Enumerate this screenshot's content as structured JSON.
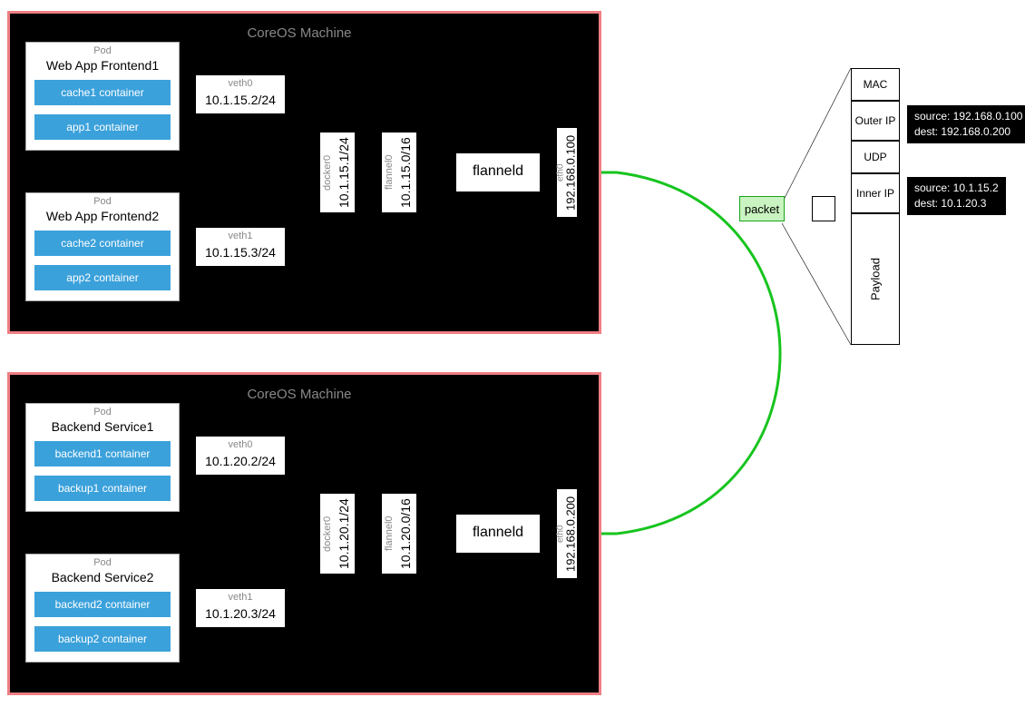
{
  "machines": {
    "top": {
      "title": "CoreOS Machine",
      "pods": [
        {
          "label": "Pod",
          "title": "Web App Frontend1",
          "c1": "cache1 container",
          "c2": "app1 container"
        },
        {
          "label": "Pod",
          "title": "Web App Frontend2",
          "c1": "cache2 container",
          "c2": "app2 container"
        }
      ],
      "veth0": {
        "label": "veth0",
        "val": "10.1.15.2/24"
      },
      "veth1": {
        "label": "veth1",
        "val": "10.1.15.3/24"
      },
      "docker0": {
        "label": "docker0",
        "val": "10.1.15.1/24"
      },
      "flannel0": {
        "label": "flannel0",
        "val": "10.1.15.0/16"
      },
      "flanneld": "flanneld",
      "eth0": {
        "label": "eth0",
        "val": "192.168.0.100"
      }
    },
    "bottom": {
      "title": "CoreOS Machine",
      "pods": [
        {
          "label": "Pod",
          "title": "Backend Service1",
          "c1": "backend1 container",
          "c2": "backup1 container"
        },
        {
          "label": "Pod",
          "title": "Backend Service2",
          "c1": "backend2 container",
          "c2": "backup2 container"
        }
      ],
      "veth0": {
        "label": "veth0",
        "val": "10.1.20.2/24"
      },
      "veth1": {
        "label": "veth1",
        "val": "10.1.20.3/24"
      },
      "docker0": {
        "label": "docker0",
        "val": "10.1.20.1/24"
      },
      "flannel0": {
        "label": "flannel0",
        "val": "10.1.20.0/16"
      },
      "flanneld": "flanneld",
      "eth0": {
        "label": "eth0",
        "val": "192.168.0.200"
      }
    }
  },
  "packet": {
    "label": "packet",
    "fields": [
      "MAC",
      "Outer IP",
      "UDP",
      "Inner IP",
      "Payload"
    ],
    "outer": {
      "src": "source: 192.168.0.100",
      "dst": "dest: 192.168.0.200"
    },
    "inner": {
      "src": "source: 10.1.15.2",
      "dst": "dest: 10.1.20.3"
    }
  }
}
